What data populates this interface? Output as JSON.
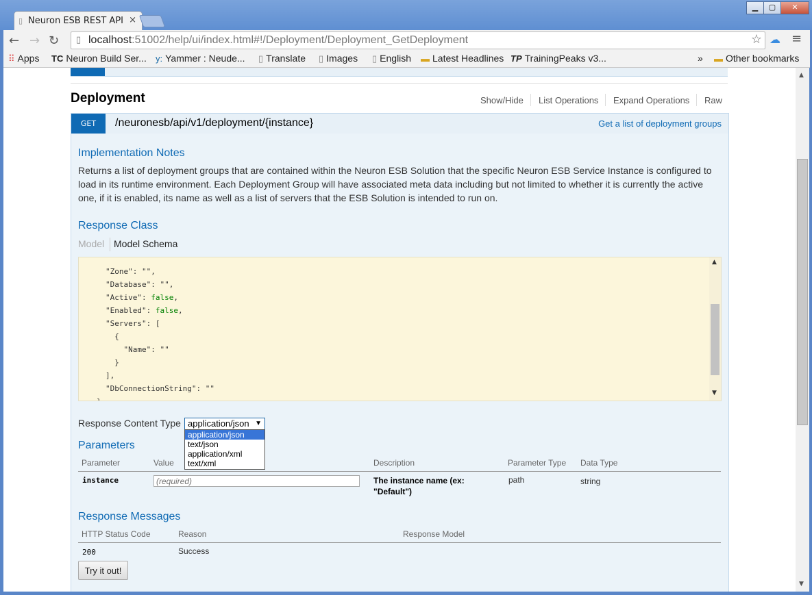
{
  "browser": {
    "tab_title": "Neuron ESB REST API",
    "tab_close": "×",
    "url_host": "localhost",
    "url_rest": ":51002/help/ui/index.html#!/Deployment/Deployment_GetDeployment",
    "bookmarks": [
      {
        "icon": "apps-icon",
        "label": "Apps"
      },
      {
        "icon": "teamcity-icon",
        "label": "Neuron Build Ser..."
      },
      {
        "icon": "yammer-icon",
        "label": "Yammer : Neude..."
      },
      {
        "icon": "page-icon",
        "label": "Translate"
      },
      {
        "icon": "page-icon",
        "label": "Images"
      },
      {
        "icon": "page-icon",
        "label": "English"
      },
      {
        "icon": "folder-icon",
        "label": "Latest Headlines"
      },
      {
        "icon": "trainingpeaks-icon",
        "label": "TrainingPeaks v3..."
      }
    ],
    "bookmarks_overflow": "»",
    "other_bookmarks": "Other bookmarks"
  },
  "page": {
    "section_title": "Deployment",
    "ops": {
      "show_hide": "Show/Hide",
      "list": "List Operations",
      "expand": "Expand Operations",
      "raw": "Raw"
    },
    "endpoint": {
      "method": "GET",
      "path": "/neuronesb/api/v1/deployment/{instance}",
      "summary": "Get a list of deployment groups"
    },
    "notes_title": "Implementation Notes",
    "notes_text": "Returns a list of deployment groups that are contained within the Neuron ESB Solution that the specific Neuron ESB Service Instance is configured to load in its runtime environment. Each Deployment Group will have associated meta data including but not limited to whether it is currently the active one, if it is enabled, its name as well as a list of servers that the ESB Solution is intended to run on.",
    "response_class_title": "Response Class",
    "model_tab": "Model",
    "model_schema_tab": "Model Schema",
    "schema_lines": [
      "\"Zone\": \"\",",
      "\"Database\": \"\",",
      "\"Active\": false,",
      "\"Enabled\": false,",
      "\"Servers\": [",
      "  {",
      "    \"Name\": \"\"",
      "  }",
      "],",
      "\"DbConnectionString\": \"\""
    ],
    "schema_close": "}",
    "content_type_label": "Response Content Type",
    "content_type_selected": "application/json",
    "content_type_options": [
      "application/json",
      "text/json",
      "application/xml",
      "text/xml"
    ],
    "parameters_title": "Parameters",
    "param_headers": [
      "Parameter",
      "Value",
      "Description",
      "Parameter Type",
      "Data Type"
    ],
    "param": {
      "name": "instance",
      "placeholder": "(required)",
      "description": "The instance name (ex: \"Default\")",
      "type": "path",
      "data_type": "string"
    },
    "messages_title": "Response Messages",
    "message_headers": [
      "HTTP Status Code",
      "Reason",
      "Response Model"
    ],
    "message": {
      "code": "200",
      "reason": "Success"
    },
    "try_button": "Try it out!"
  }
}
